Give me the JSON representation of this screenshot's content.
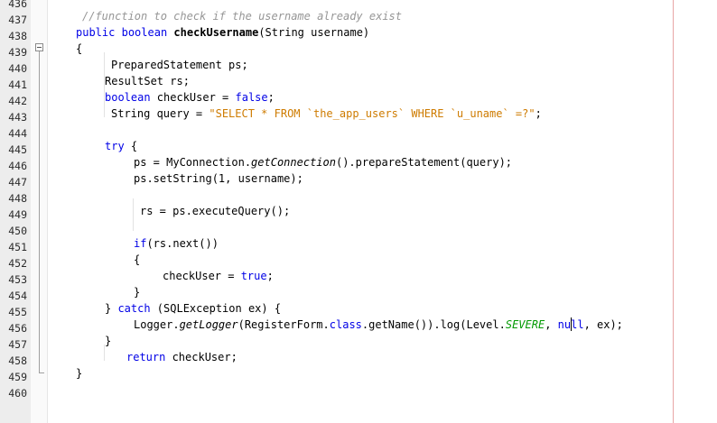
{
  "editor": {
    "line_numbers": [
      "436",
      "437",
      "438",
      "439",
      "440",
      "441",
      "442",
      "443",
      "444",
      "445",
      "446",
      "447",
      "448",
      "449",
      "450",
      "451",
      "452",
      "453",
      "454",
      "455",
      "456",
      "457",
      "458",
      "459",
      "460"
    ],
    "comment": "//function to check if the username already exist",
    "l437": {
      "kw_public": "public",
      "kw_boolean": "boolean",
      "method": "checkUsername",
      "params": "(String username)"
    },
    "l438": {
      "brace": "{"
    },
    "l439": {
      "text": "PreparedStatement ps;"
    },
    "l440": {
      "text": "ResultSet rs;"
    },
    "l441": {
      "kw": "boolean",
      "mid": " checkUser = ",
      "kw_false": "false",
      "end": ";"
    },
    "l442": {
      "pre": "String query = ",
      "str": "\"SELECT * FROM `the_app_users` WHERE `u_uname` =?\"",
      "end": ";"
    },
    "l444": {
      "kw": "try",
      "rest": " {"
    },
    "l445": {
      "pre": "ps = MyConnection.",
      "call": "getConnection",
      "rest": "().prepareStatement(query);"
    },
    "l446": {
      "text": "ps.setString(1, username);"
    },
    "l448": {
      "text": "rs = ps.executeQuery();"
    },
    "l450": {
      "kw": "if",
      "rest": "(rs.next())"
    },
    "l451": {
      "brace": "{"
    },
    "l452": {
      "pre": "checkUser = ",
      "kw": "true",
      "end": ";"
    },
    "l453": {
      "brace": "}"
    },
    "l454": {
      "pre": "} ",
      "kw": "catch",
      "rest": " (SQLException ex) {"
    },
    "l455": {
      "pre": "Logger.",
      "call": "getLogger",
      "mid": "(RegisterForm.",
      "kw_class": "class",
      "mid2": ".getName()).log(Level.",
      "enum": "SEVERE",
      "sep": ", ",
      "kw_null_a": "nu",
      "kw_null_b": "ll",
      "end": ", ex);"
    },
    "l456": {
      "brace": "}"
    },
    "l457": {
      "kw": "return",
      "rest": " checkUser;"
    },
    "l458": {
      "brace": "}"
    }
  },
  "colors": {
    "keyword": "#0000e6",
    "string": "#ce7b00",
    "comment": "#969696",
    "enum_constant": "#009900",
    "right_margin": "#e8a6a6"
  }
}
